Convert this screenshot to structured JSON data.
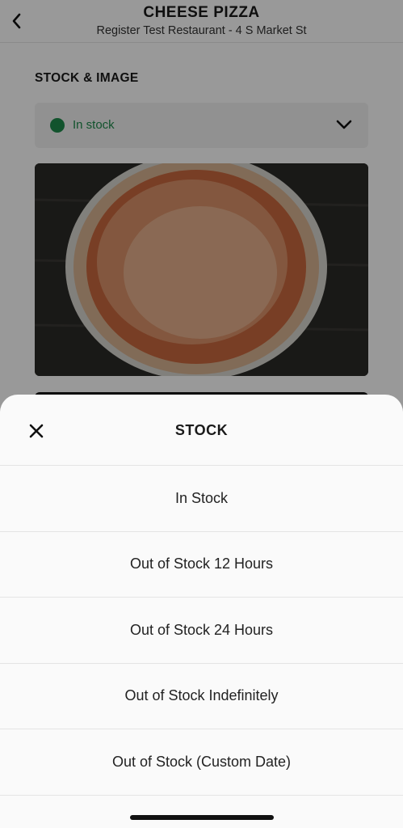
{
  "header": {
    "title": "CHEESE PIZZA",
    "subtitle": "Register Test Restaurant - 4 S Market St",
    "back_icon": "chevron-left-icon"
  },
  "section": {
    "heading": "STOCK & IMAGE"
  },
  "stock_select": {
    "value": "In stock",
    "status_color": "#1f8a4c",
    "icon": "chevron-down-icon"
  },
  "product_image": {
    "subject": "cheese pizza photo"
  },
  "sheet": {
    "title": "STOCK",
    "close_icon": "close-icon",
    "options": [
      {
        "label": "In Stock"
      },
      {
        "label": "Out of Stock 12 Hours"
      },
      {
        "label": "Out of Stock 24 Hours"
      },
      {
        "label": "Out of Stock Indefinitely"
      },
      {
        "label": "Out of Stock (Custom Date)"
      }
    ]
  }
}
